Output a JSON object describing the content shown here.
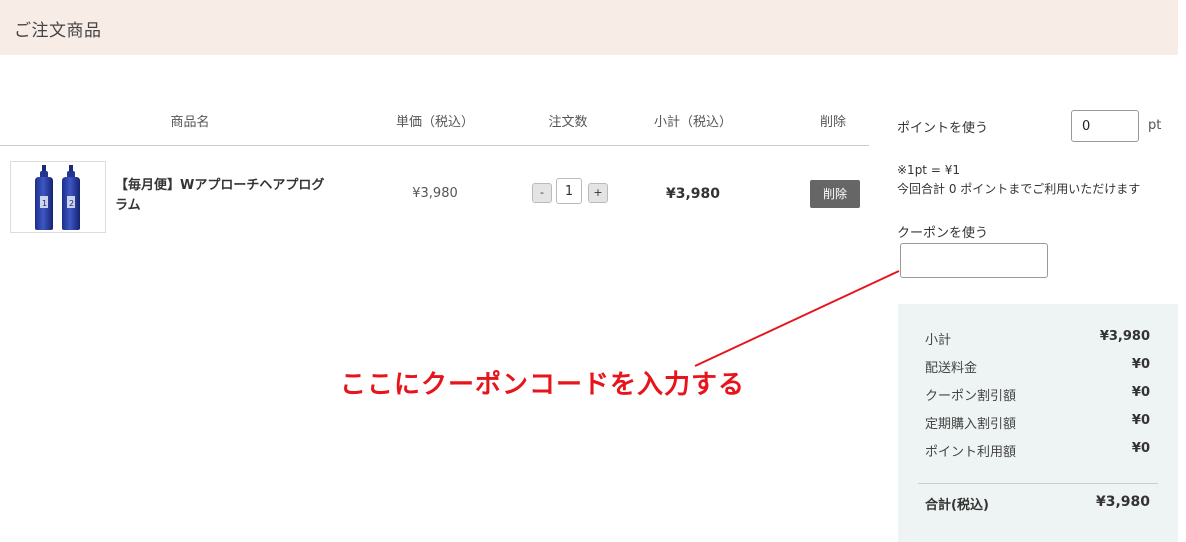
{
  "section": {
    "title": "ご注文商品"
  },
  "table": {
    "headers": {
      "name": "商品名",
      "price": "単価（税込）",
      "qty": "注文数",
      "subtotal": "小計（税込）",
      "delete": "削除"
    },
    "rows": [
      {
        "product_name": "【毎月便】Wアプローチヘアプログラム",
        "unit_price": "¥3,980",
        "qty_minus": "-",
        "qty": "1",
        "qty_plus": "+",
        "subtotal": "¥3,980",
        "delete_label": "削除"
      }
    ]
  },
  "points": {
    "label": "ポイントを使う",
    "value": "0",
    "unit": "pt",
    "rate": "※1pt = ¥1",
    "available": "今回合計 0 ポイントまでご利用いただけます"
  },
  "coupon": {
    "label": "クーポンを使う",
    "value": ""
  },
  "summary": {
    "rows": [
      {
        "label": "小計",
        "value": "¥3,980"
      },
      {
        "label": "配送料金",
        "value": "¥0"
      },
      {
        "label": "クーポン割引額",
        "value": "¥0"
      },
      {
        "label": "定期購入割引額",
        "value": "¥0"
      },
      {
        "label": "ポイント利用額",
        "value": "¥0"
      }
    ],
    "total_label": "合計(税込)",
    "total_value": "¥3,980"
  },
  "annotation": {
    "text": "ここにクーポンコードを入力する",
    "color": "#e8141c"
  },
  "colors": {
    "header_bg": "#f8ece7",
    "summary_bg": "#eef4f3",
    "delete_button": "#666666"
  }
}
